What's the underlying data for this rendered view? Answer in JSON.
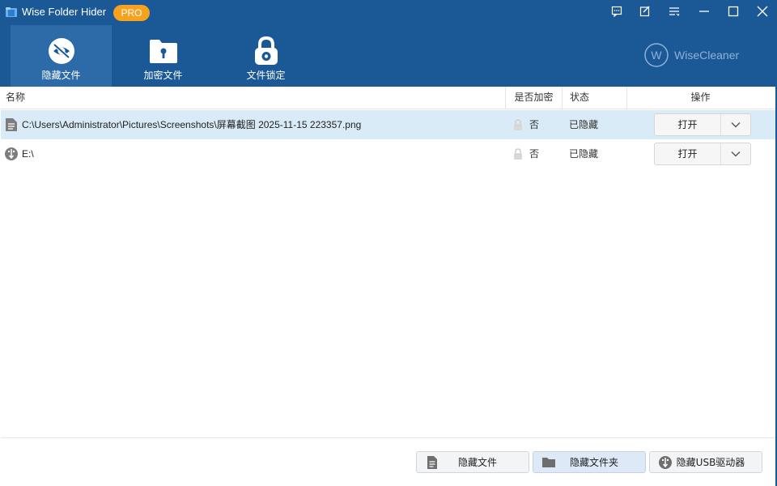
{
  "app": {
    "title": "Wise Folder Hider",
    "badge": "PRO",
    "brand": "WiseCleaner",
    "brand_mark": "W",
    "accent": "#1b5896",
    "badge_color": "#f6a21f"
  },
  "window_controls": [
    "feedback-icon",
    "edit-icon",
    "menu-icon",
    "minimize-icon",
    "maximize-icon",
    "close-icon"
  ],
  "tabs": [
    {
      "label": "隐藏文件",
      "icon": "eye-slash-icon",
      "active": true
    },
    {
      "label": "加密文件",
      "icon": "folder-lock-icon",
      "active": false
    },
    {
      "label": "文件锁定",
      "icon": "padlock-icon",
      "active": false
    }
  ],
  "table": {
    "headers": {
      "name": "名称",
      "encrypted": "是否加密",
      "status": "状态",
      "action": "操作"
    },
    "rows": [
      {
        "icon": "file-icon",
        "path": "C:\\Users\\Administrator\\Pictures\\Screenshots\\屏幕截图 2025-11-15 223357.png",
        "encrypted": "否",
        "status": "已隐藏",
        "action": "打开",
        "selected": true
      },
      {
        "icon": "usb-drive-icon",
        "path": "E:\\",
        "encrypted": "否",
        "status": "已隐藏",
        "action": "打开",
        "selected": false
      }
    ]
  },
  "bottom_buttons": [
    {
      "label": "隐藏文件",
      "icon": "file-icon"
    },
    {
      "label": "隐藏文件夹",
      "icon": "folder-icon"
    },
    {
      "label": "隐藏USB驱动器",
      "icon": "usb-drive-icon"
    }
  ]
}
